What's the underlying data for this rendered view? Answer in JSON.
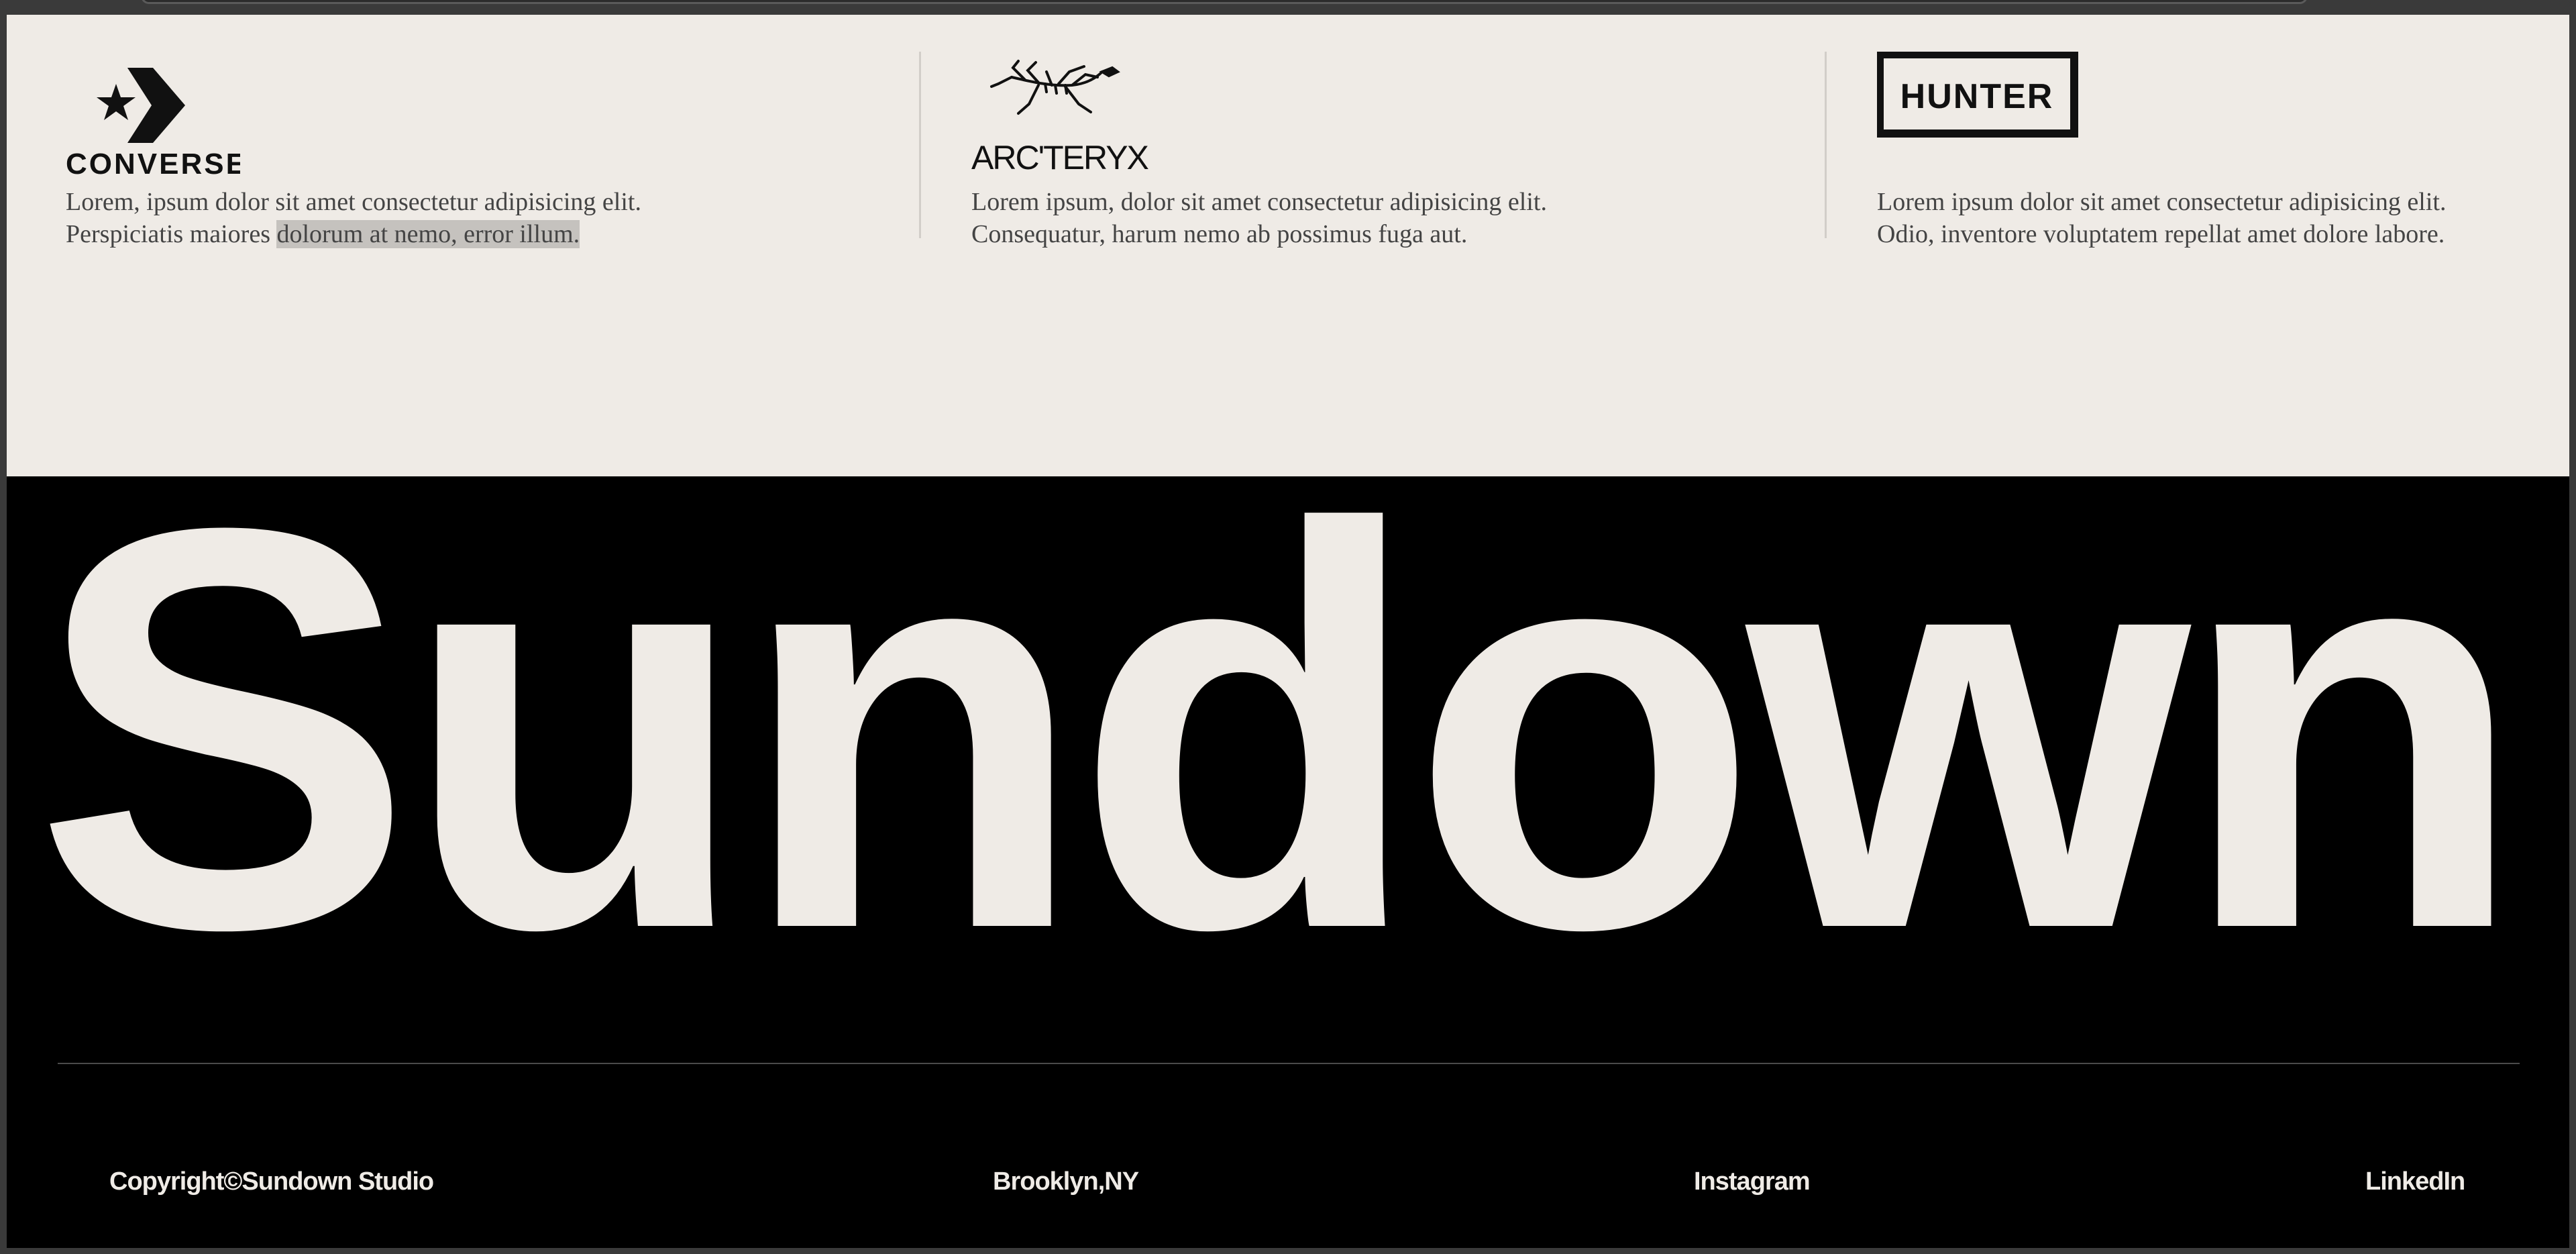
{
  "brands": [
    {
      "name": "CONVERSE",
      "logo_icon": "converse-star-chevron",
      "desc_line1": "Lorem, ipsum dolor sit amet consectetur adipisicing elit.",
      "desc_line2_a": "Perspiciatis maiores ",
      "desc_line2_b": "dolorum at nemo, error illum."
    },
    {
      "name": "ARC'TERYX",
      "logo_icon": "archaeopteryx-fossil",
      "desc_line1": "Lorem ipsum, dolor sit amet consectetur adipisicing elit.",
      "desc_line2": "Consequatur, harum nemo ab possimus fuga aut."
    },
    {
      "name": "HUNTER",
      "logo_icon": "hunter-box",
      "desc_line1": "Lorem ipsum dolor sit amet consectetur adipisicing elit.",
      "desc_line2": "Odio, inventore voluptatem repellat amet dolore labore."
    }
  ],
  "hero": {
    "wordmark": "Sundown"
  },
  "footer": {
    "copyright": "Copyright©Sundown Studio",
    "location": "Brooklyn,NY",
    "instagram": "Instagram",
    "linkedin": "LinkedIn"
  },
  "colors": {
    "cream": "#efebe6",
    "black": "#000000",
    "text": "#444444",
    "highlight": "#c5c2be"
  }
}
